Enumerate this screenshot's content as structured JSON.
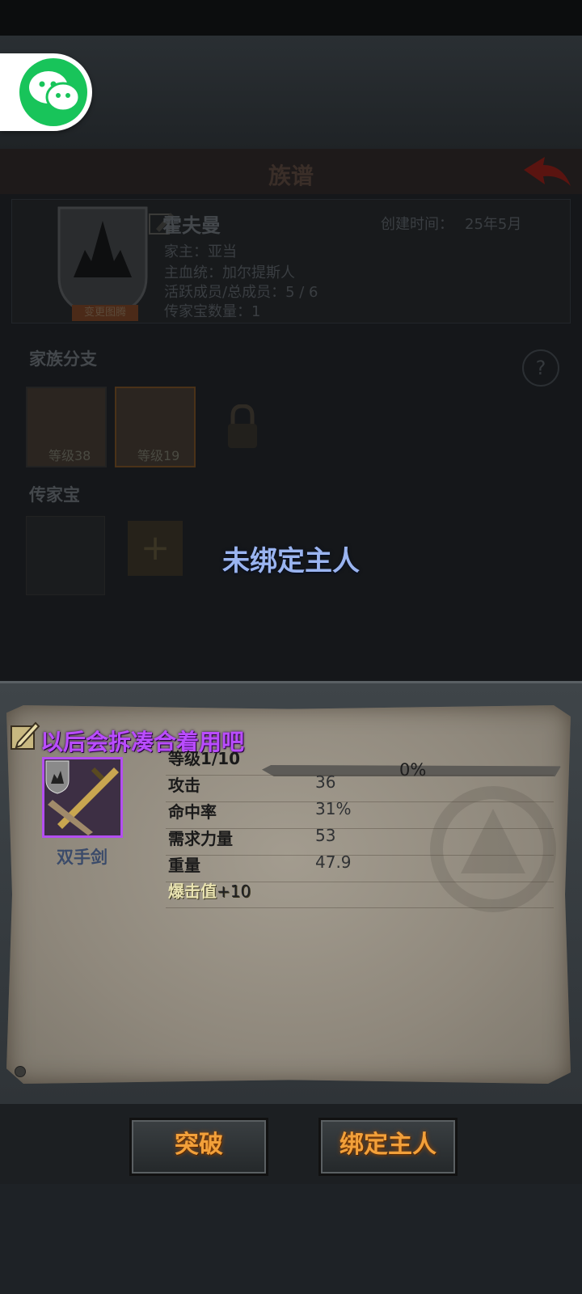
{
  "wechat": {
    "icon": "wechat-icon",
    "color": "#18c45a"
  },
  "window": {
    "title": "族谱",
    "back_icon": "back-arrow-icon"
  },
  "family": {
    "name": "霍夫曼",
    "created_label": "创建时间：",
    "created_value": "25年5月",
    "head": "家主：亚当",
    "bloodline": "主血统：加尔提斯人",
    "members": "活跃成员/总成员：5 / 6",
    "heirloom_count": "传家宝数量：1",
    "crest_label": "变更图腾"
  },
  "branches": {
    "title": "家族分支",
    "help": "?",
    "members": [
      {
        "level": "等级38"
      },
      {
        "level": "等级19"
      }
    ]
  },
  "heirlooms": {
    "title": "传家宝",
    "add": "+"
  },
  "overlay": {
    "unbound": "未绑定主人"
  },
  "item": {
    "title": "以后会拆凑合着用吧",
    "name": "双手剑",
    "level_label": "等级1/10",
    "level_pct": "0%",
    "level_progress": 0,
    "stats": [
      {
        "label": "攻击",
        "value": "36"
      },
      {
        "label": "命中率",
        "value": "31%"
      },
      {
        "label": "需求力量",
        "value": "53"
      },
      {
        "label": "重量",
        "value": "47.9"
      }
    ],
    "bonus_label": "爆击值",
    "bonus_value": "+10",
    "rarity_color": "#b34ef0"
  },
  "actions": {
    "breakthrough": "突破",
    "bind": "绑定主人"
  }
}
